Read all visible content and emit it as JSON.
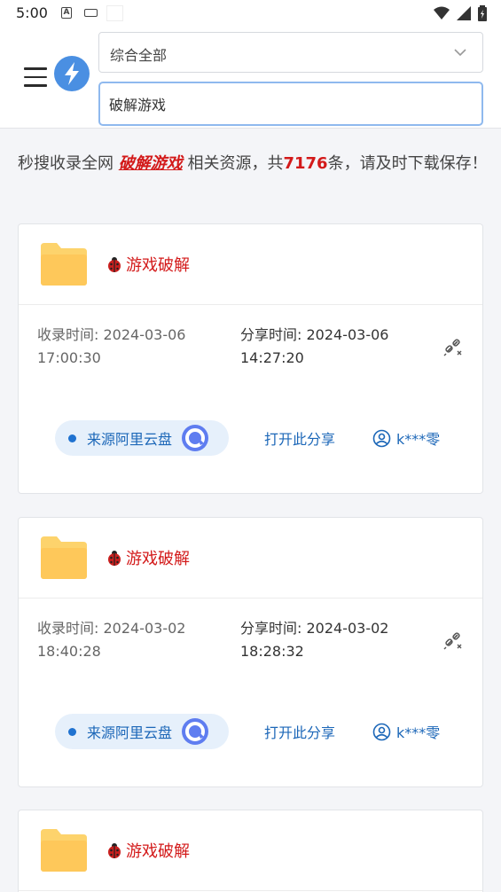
{
  "status_bar": {
    "time": "5:00",
    "a_icon_letter": "A"
  },
  "header": {
    "category_select": {
      "value": "综合全部"
    },
    "search": {
      "value": "破解游戏"
    }
  },
  "summary": {
    "prefix": "秒搜收录全网 ",
    "keyword": "破解游戏",
    "middle": " 相关资源，共",
    "count": "7176",
    "suffix": "条，请及时下载保存！"
  },
  "labels": {
    "collected_prefix": "收录时间: ",
    "shared_prefix": "分享时间: ",
    "open_share": "打开此分享"
  },
  "results": [
    {
      "title": "游戏破解",
      "collected_date": "2024-03-06",
      "collected_time": "17:00:30",
      "shared_date": "2024-03-06",
      "shared_time": "14:27:20",
      "source": "来源阿里云盘",
      "user": "k***零"
    },
    {
      "title": "游戏破解",
      "collected_date": "2024-03-02",
      "collected_time": "18:40:28",
      "shared_date": "2024-03-02",
      "shared_time": "18:28:32",
      "source": "来源阿里云盘",
      "user": "k***零"
    },
    {
      "title": "游戏破解"
    }
  ],
  "colors": {
    "accent_blue": "#1c67b8",
    "highlight_red": "#d31a1a",
    "logo_blue": "#4a8fe2",
    "folder_yellow": "#fdd36c"
  },
  "icons": [
    "menu-icon",
    "lightning-logo-icon",
    "chevron-down-icon",
    "folder-icon",
    "ladybug-icon",
    "unlink-icon",
    "aliyun-drive-icon",
    "user-circle-icon",
    "wifi-icon",
    "signal-icon",
    "battery-icon"
  ]
}
